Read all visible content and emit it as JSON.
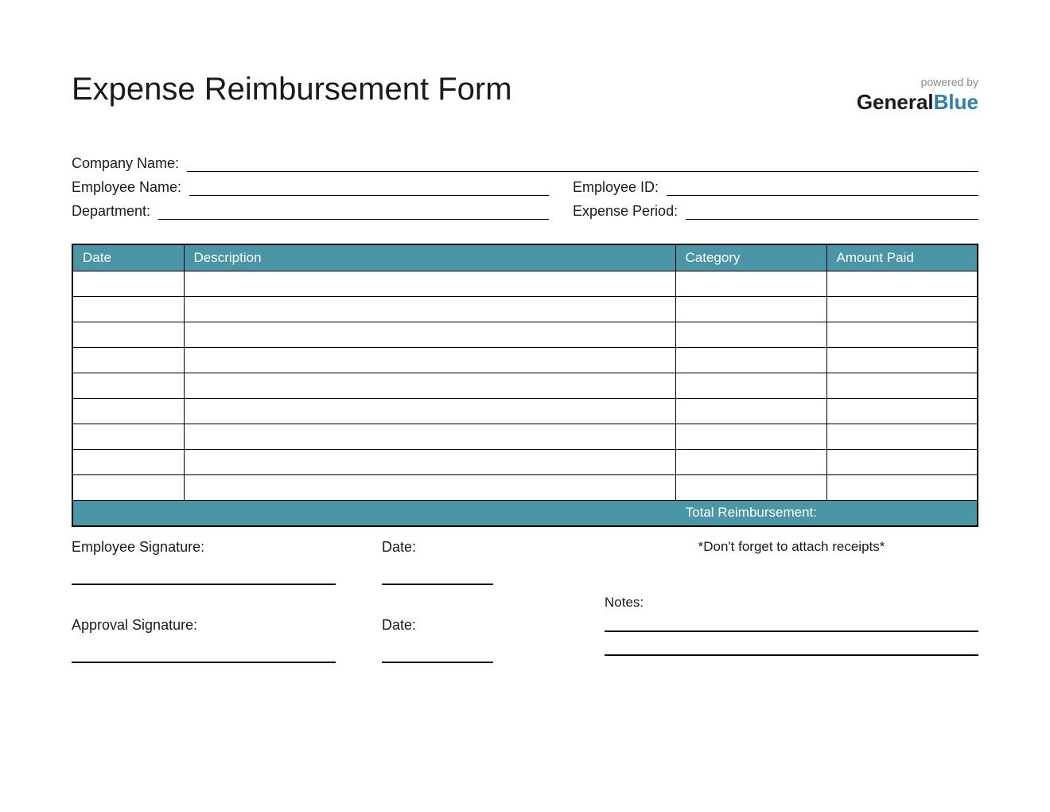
{
  "title": "Expense Reimbursement Form",
  "logo": {
    "powered_by": "powered by",
    "general": "General",
    "blue": "Blue"
  },
  "info": {
    "company_name_label": "Company Name:",
    "employee_name_label": "Employee Name:",
    "employee_id_label": "Employee ID:",
    "department_label": "Department:",
    "expense_period_label": "Expense Period:"
  },
  "table": {
    "headers": {
      "date": "Date",
      "description": "Description",
      "category": "Category",
      "amount": "Amount Paid"
    },
    "row_count": 9,
    "total_label": "Total Reimbursement:"
  },
  "signatures": {
    "employee_sig_label": "Employee Signature:",
    "approval_sig_label": "Approval Signature:",
    "date_label": "Date:",
    "receipts_note": "*Don't forget to attach receipts*",
    "notes_label": "Notes:"
  }
}
